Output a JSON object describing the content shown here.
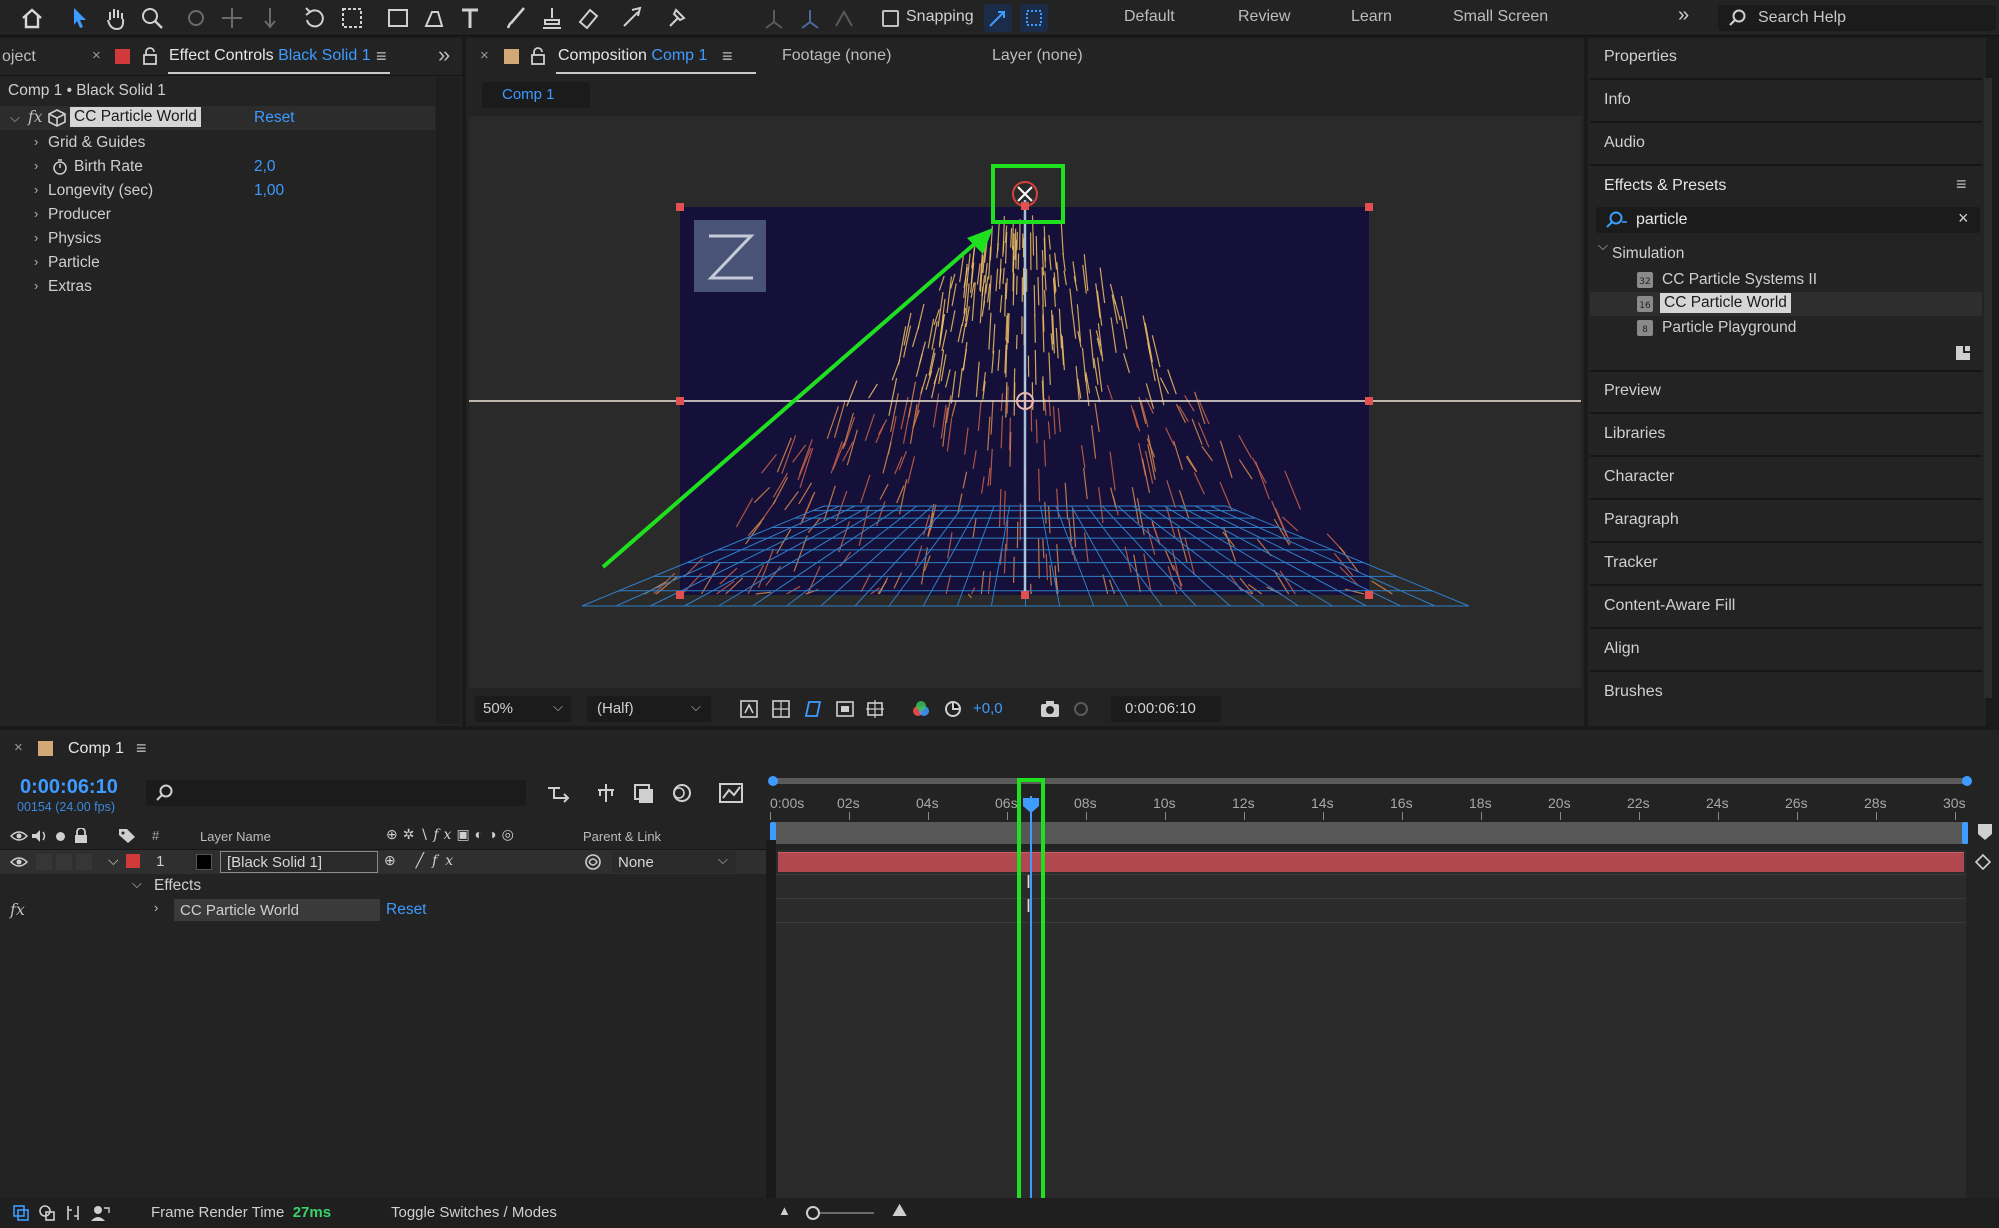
{
  "toolbar": {
    "snapping_label": "Snapping",
    "workspaces": [
      "Default",
      "Review",
      "Learn",
      "Small Screen"
    ],
    "search_placeholder": "Search Help"
  },
  "left_panel": {
    "project_tab": "oject",
    "tab_title": "Effect Controls",
    "tab_layer": "Black Solid 1",
    "breadcrumb": "Comp 1 • Black Solid 1",
    "effect_name": "CC Particle World",
    "reset_label": "Reset",
    "properties": [
      {
        "label": "Grid & Guides",
        "value": ""
      },
      {
        "label": "Birth Rate",
        "value": "2,0"
      },
      {
        "label": "Longevity (sec)",
        "value": "1,00"
      },
      {
        "label": "Producer",
        "value": ""
      },
      {
        "label": "Physics",
        "value": ""
      },
      {
        "label": "Particle",
        "value": ""
      },
      {
        "label": "Extras",
        "value": ""
      }
    ]
  },
  "comp_panel": {
    "tab_title": "Composition",
    "tab_comp": "Comp 1",
    "footage_tab": "Footage (none)",
    "layer_tab": "Layer (none)",
    "comp_chip": "Comp 1",
    "zoom": "50%",
    "resolution": "(Half)",
    "exposure": "+0,0",
    "timecode": "0:00:06:10"
  },
  "right_panel": {
    "top_items": [
      "Properties",
      "Info",
      "Audio"
    ],
    "effects_title": "Effects & Presets",
    "search_value": "particle",
    "category": "Simulation",
    "effects": [
      "CC Particle Systems II",
      "CC Particle World",
      "Particle Playground"
    ],
    "bottom_items": [
      "Preview",
      "Libraries",
      "Character",
      "Paragraph",
      "Tracker",
      "Content-Aware Fill",
      "Align",
      "Brushes"
    ]
  },
  "timeline": {
    "comp_tab": "Comp 1",
    "current_time": "0:00:06:10",
    "frame_info": "00154 (24.00 fps)",
    "col_hash": "#",
    "col_layer_name": "Layer Name",
    "col_parent": "Parent & Link",
    "layer_number": "1",
    "layer_name": "[Black Solid 1]",
    "parent_value": "None",
    "effects_label": "Effects",
    "effect_name": "CC Particle World",
    "reset_label": "Reset",
    "ticks": [
      "0:00s",
      "02s",
      "04s",
      "06s",
      "08s",
      "10s",
      "12s",
      "14s",
      "16s",
      "18s",
      "20s",
      "22s",
      "24s",
      "26s",
      "28s",
      "30s"
    ]
  },
  "statusbar": {
    "frame_render_label": "Frame Render Time",
    "frame_render_value": "27ms",
    "toggle_label": "Toggle Switches / Modes"
  },
  "colors": {
    "accent_blue": "#3e9bff",
    "highlight_green": "#1fe01f",
    "layer_bar": "#b1474f",
    "comp_bg": "#14103a"
  }
}
